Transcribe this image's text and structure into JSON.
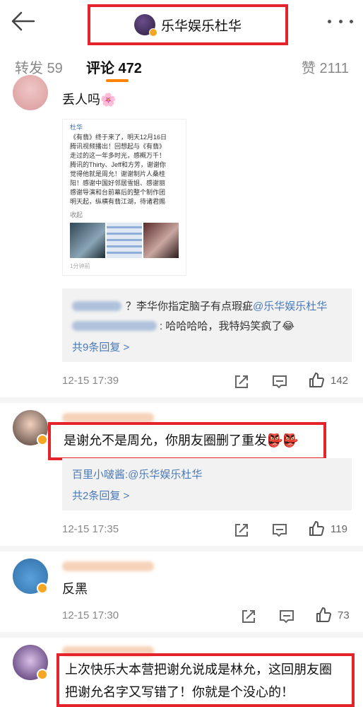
{
  "header": {
    "title": "乐华娱乐杜华",
    "back_icon": "arrow-left-icon",
    "more_icon": "more-dots-icon"
  },
  "tabs": [
    {
      "label": "转发 59"
    },
    {
      "label": "评论 472"
    },
    {
      "label": "赞 2111"
    }
  ],
  "comment1": {
    "text": "丢人吗🌸",
    "post": {
      "name": "杜华",
      "lines": [
        "《有翡》终于来了，明天12月16日",
        "腾讯视频播出！回想起与《有翡》",
        "走过的这一年多时光，感概万千！",
        "腾讯的Thirty、Jeff和方芳，谢谢你",
        "觉得他就是周允！谢谢制片人桑桂",
        "阳！感谢中国好邻居雪姐、感谢丽",
        "感谢导演和台前幕后的整个制作团",
        "明天起，纵横有翡江湖，待诸君赐"
      ],
      "collapse": "收起",
      "time": "1分钟前"
    },
    "replies": [
      {
        "text": "？李华你指定脑子有点瑕疵",
        "mention": "@乐华娱乐杜华"
      },
      {
        "text": ": 哈哈哈哈，我特妈笑疯了😂",
        "mention": ""
      }
    ],
    "more_replies": "共9条回复 >",
    "time": "12-15 17:39",
    "likes": "142"
  },
  "comment2": {
    "text": "是谢允不是周允，你朋友圈删了重发👺👺",
    "reply_name": "百里小啵酱:",
    "reply_mention": "@乐华娱乐杜华",
    "more_replies": "共2条回复 >",
    "time": "12-15 17:35",
    "likes": "119"
  },
  "comment3": {
    "text": "反黑",
    "time": "12-15 17:30",
    "likes": "73"
  },
  "comment4": {
    "line1": "上次快乐大本营把谢允说成是林允，这回朋友圈",
    "line2": "把谢允名字又写错了！你就是个没心的！"
  },
  "colors": {
    "accent": "#ff8200",
    "link": "#4a7ab7",
    "highlight_box": "#e5232b"
  }
}
